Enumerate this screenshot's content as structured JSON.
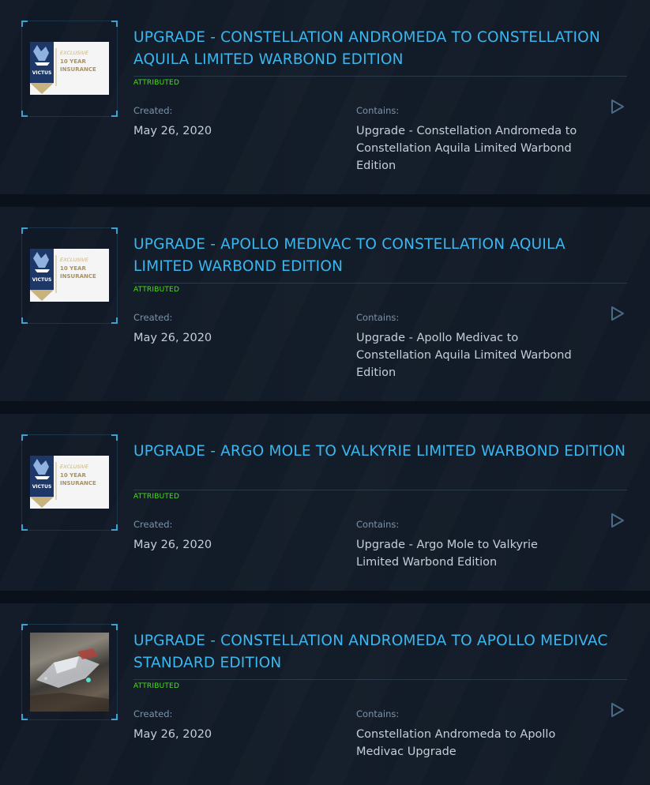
{
  "items": [
    {
      "title": "UPGRADE - CONSTELLATION ANDROMEDA TO CONSTELLATION AQUILA LIMITED WARBOND EDITION",
      "status": "ATTRIBUTED",
      "created_label": "Created:",
      "created_value": "May 26, 2020",
      "contains_label": "Contains:",
      "contains_value": "Upgrade - Constellation Andromeda to Constellation Aquila Limited Warbond Edition",
      "thumb": {
        "brand": "VICTUS",
        "line1": "EXCLUSIVE",
        "line2": "10 YEAR",
        "line3": "INSURANCE"
      }
    },
    {
      "title": "UPGRADE - APOLLO MEDIVAC TO CONSTELLATION AQUILA LIMITED WARBOND EDITION",
      "status": "ATTRIBUTED",
      "created_label": "Created:",
      "created_value": "May 26, 2020",
      "contains_label": "Contains:",
      "contains_value": "Upgrade - Apollo Medivac to Constellation Aquila Limited Warbond Edition",
      "thumb": {
        "brand": "VICTUS",
        "line1": "EXCLUSIVE",
        "line2": "10 YEAR",
        "line3": "INSURANCE"
      }
    },
    {
      "title": "UPGRADE - ARGO MOLE TO VALKYRIE LIMITED WARBOND EDITION",
      "status": "ATTRIBUTED",
      "created_label": "Created:",
      "created_value": "May 26, 2020",
      "contains_label": "Contains:",
      "contains_value": "Upgrade - Argo Mole to Valkyrie Limited Warbond Edition",
      "thumb": {
        "brand": "VICTUS",
        "line1": "EXCLUSIVE",
        "line2": "10 YEAR",
        "line3": "INSURANCE"
      }
    },
    {
      "title": "UPGRADE - CONSTELLATION ANDROMEDA TO APOLLO MEDIVAC STANDARD EDITION",
      "status": "ATTRIBUTED",
      "created_label": "Created:",
      "created_value": "May 26, 2020",
      "contains_label": "Contains:",
      "contains_value": "Constellation Andromeda to Apollo Medivac Upgrade"
    }
  ],
  "colors": {
    "title": "#3cb6ef",
    "status": "#49e21a",
    "label": "#7c93a9",
    "value": "#c4ced8",
    "background": "#0a111b"
  },
  "icons": {
    "expand": "play-triangle-icon",
    "insurance_badge": "victus-insurance-badge",
    "ship_photo": "ship-image"
  }
}
